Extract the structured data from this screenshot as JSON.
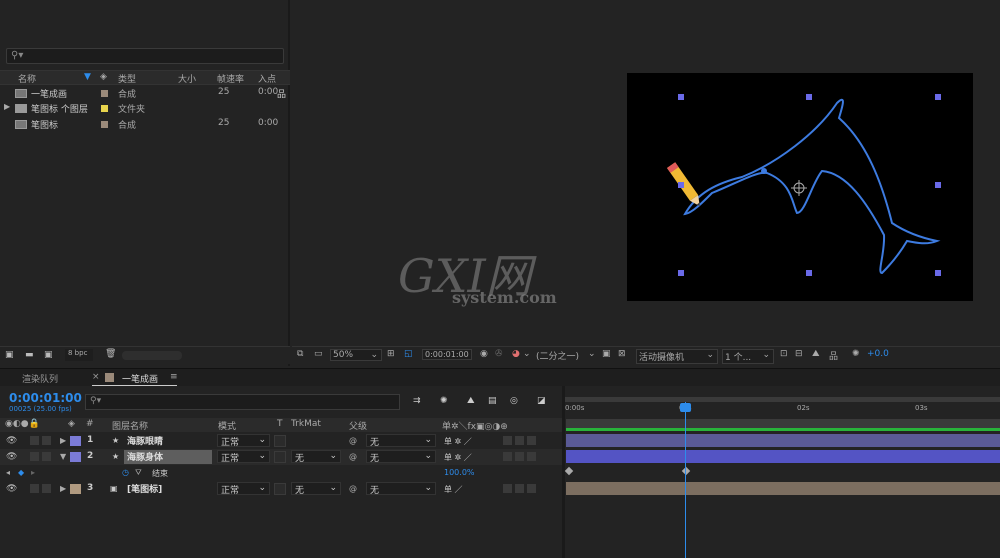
{
  "project": {
    "search_icon": "search-icon",
    "columns": [
      "名称",
      "类型",
      "大小",
      "帧速率",
      "入点"
    ],
    "items": [
      {
        "name": "一笔成画",
        "type": "合成",
        "fps": "25",
        "in": "0:00",
        "label_color": "#9b8a7a"
      },
      {
        "name": "笔图标 个图层",
        "type": "文件夹",
        "fps": "",
        "in": "",
        "label_color": "#e8d44d"
      },
      {
        "name": "笔图标",
        "type": "合成",
        "fps": "25",
        "in": "0:00",
        "label_color": "#9b8a7a"
      }
    ],
    "bpc": "8 bpc"
  },
  "viewer": {
    "zoom": "50%",
    "timecode": "0:00:01:00",
    "resolution": "(二分之一)",
    "camera": "活动摄像机",
    "views": "1 个...",
    "exposure": "+0.0"
  },
  "tabs": {
    "render_queue": "渲染队列",
    "comp": "一笔成画"
  },
  "timeline": {
    "timecode": "0:00:01:00",
    "frames": "00025 (25.00 fps)",
    "headers": {
      "num": "#",
      "name": "图层名称",
      "mode": "模式",
      "t": "T",
      "trkmat": "TrkMat",
      "parent": "父级"
    },
    "layers": [
      {
        "num": "1",
        "name": "海豚眼睛",
        "mode": "正常",
        "trkmat": "",
        "parent": "无",
        "color": "#7b7bd6"
      },
      {
        "num": "2",
        "name": "海豚身体",
        "mode": "正常",
        "trkmat": "无",
        "parent": "无",
        "color": "#7b7bd6"
      },
      {
        "num": "3",
        "name": "[笔图标]",
        "mode": "正常",
        "trkmat": "无",
        "parent": "无",
        "color": "#b09a80"
      }
    ],
    "property": {
      "name": "结束",
      "value": "100.0%"
    },
    "ruler": [
      "0:00s",
      "01s",
      "02s",
      "03s"
    ]
  },
  "watermark": {
    "main": "GXI网",
    "sub": "system.com"
  }
}
